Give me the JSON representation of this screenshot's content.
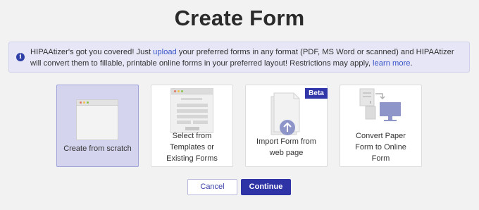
{
  "page": {
    "title": "Create Form"
  },
  "info": {
    "text_before_upload": "HIPAAtizer's got you covered! Just ",
    "upload_link": "upload",
    "text_after_upload": " your preferred forms in any format (PDF, MS Word or scanned) and HIPAAtizer will convert them to fillable, printable online forms in your preferred layout! Restrictions may apply, ",
    "learn_more_link": "learn more",
    "text_end": "."
  },
  "options": [
    {
      "id": "scratch",
      "label": "Create from scratch",
      "selected": true
    },
    {
      "id": "templates",
      "label_lines": [
        "Select from",
        "Templates or",
        "Existing Forms"
      ],
      "selected": false
    },
    {
      "id": "import",
      "label_lines": [
        "Import Form from",
        "web page"
      ],
      "badge": "Beta",
      "selected": false
    },
    {
      "id": "convert",
      "label_lines": [
        "Convert Paper",
        "Form to Online",
        "Form"
      ],
      "selected": false
    }
  ],
  "buttons": {
    "cancel": "Cancel",
    "continue": "Continue"
  },
  "colors": {
    "accent": "#2e33a5",
    "selected_card": "#d4d4ee",
    "banner": "#e6e6f6",
    "link": "#3a56c8"
  }
}
